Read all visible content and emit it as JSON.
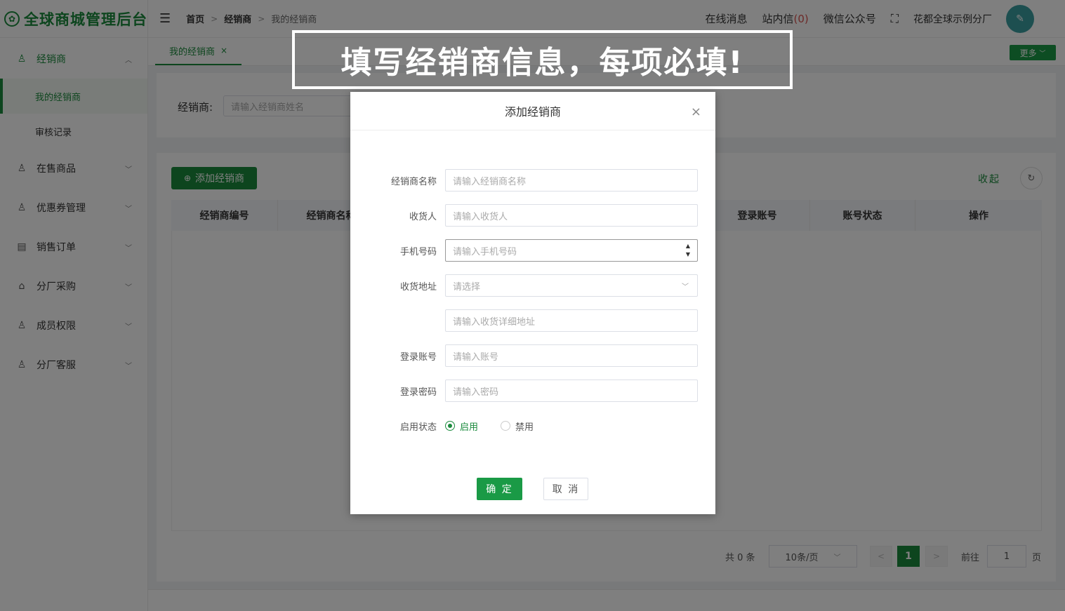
{
  "app": {
    "title": "全球商城管理后台"
  },
  "sidebar": {
    "items": [
      {
        "label": "经销商",
        "icon": "user-icon",
        "open": true,
        "children": [
          {
            "label": "我的经销商",
            "active": true
          },
          {
            "label": "审核记录"
          }
        ]
      },
      {
        "label": "在售商品",
        "icon": "user-icon"
      },
      {
        "label": "优惠券管理",
        "icon": "user-icon"
      },
      {
        "label": "销售订单",
        "icon": "clipboard-icon"
      },
      {
        "label": "分厂采购",
        "icon": "store-icon"
      },
      {
        "label": "成员权限",
        "icon": "users-icon"
      },
      {
        "label": "分厂客服",
        "icon": "users-icon"
      }
    ]
  },
  "header": {
    "breadcrumb": [
      "首页",
      "经销商",
      "我的经销商"
    ],
    "online_msg": "在线消息",
    "inbox_label": "站内信",
    "inbox_count": "(0)",
    "wechat": "微信公众号",
    "user": "花都全球示例分厂"
  },
  "tabs": {
    "active": "我的经销商",
    "more": "更多"
  },
  "search": {
    "label": "经销商:",
    "placeholder": "请输入经销商姓名"
  },
  "table": {
    "add_button": "添加经销商",
    "collapse": "收起",
    "columns": [
      "经销商编号",
      "经销商名称",
      "",
      "",
      "",
      "",
      "登录账号",
      "账号状态",
      "操作"
    ]
  },
  "pagination": {
    "total": "共 0 条",
    "page_size": "10条/页",
    "current": "1",
    "goto": "前往",
    "goto_value": "1",
    "page_unit": "页"
  },
  "banner": {
    "text": "填写经销商信息，每项必填!"
  },
  "dialog": {
    "title": "添加经销商",
    "fields": {
      "name": {
        "label": "经销商名称",
        "placeholder": "请输入经销商名称"
      },
      "receiver": {
        "label": "收货人",
        "placeholder": "请输入收货人"
      },
      "phone": {
        "label": "手机号码",
        "placeholder": "请输入手机号码"
      },
      "address": {
        "label": "收货地址",
        "placeholder": "请选择"
      },
      "address_detail": {
        "placeholder": "请输入收货详细地址"
      },
      "account": {
        "label": "登录账号",
        "placeholder": "请输入账号"
      },
      "password": {
        "label": "登录密码",
        "placeholder": "请输入密码"
      },
      "status": {
        "label": "启用状态",
        "options": [
          "启用",
          "禁用"
        ],
        "selected": "启用"
      }
    },
    "confirm": "确 定",
    "cancel": "取 消"
  },
  "colors": {
    "brand": "#1a8a3c"
  }
}
